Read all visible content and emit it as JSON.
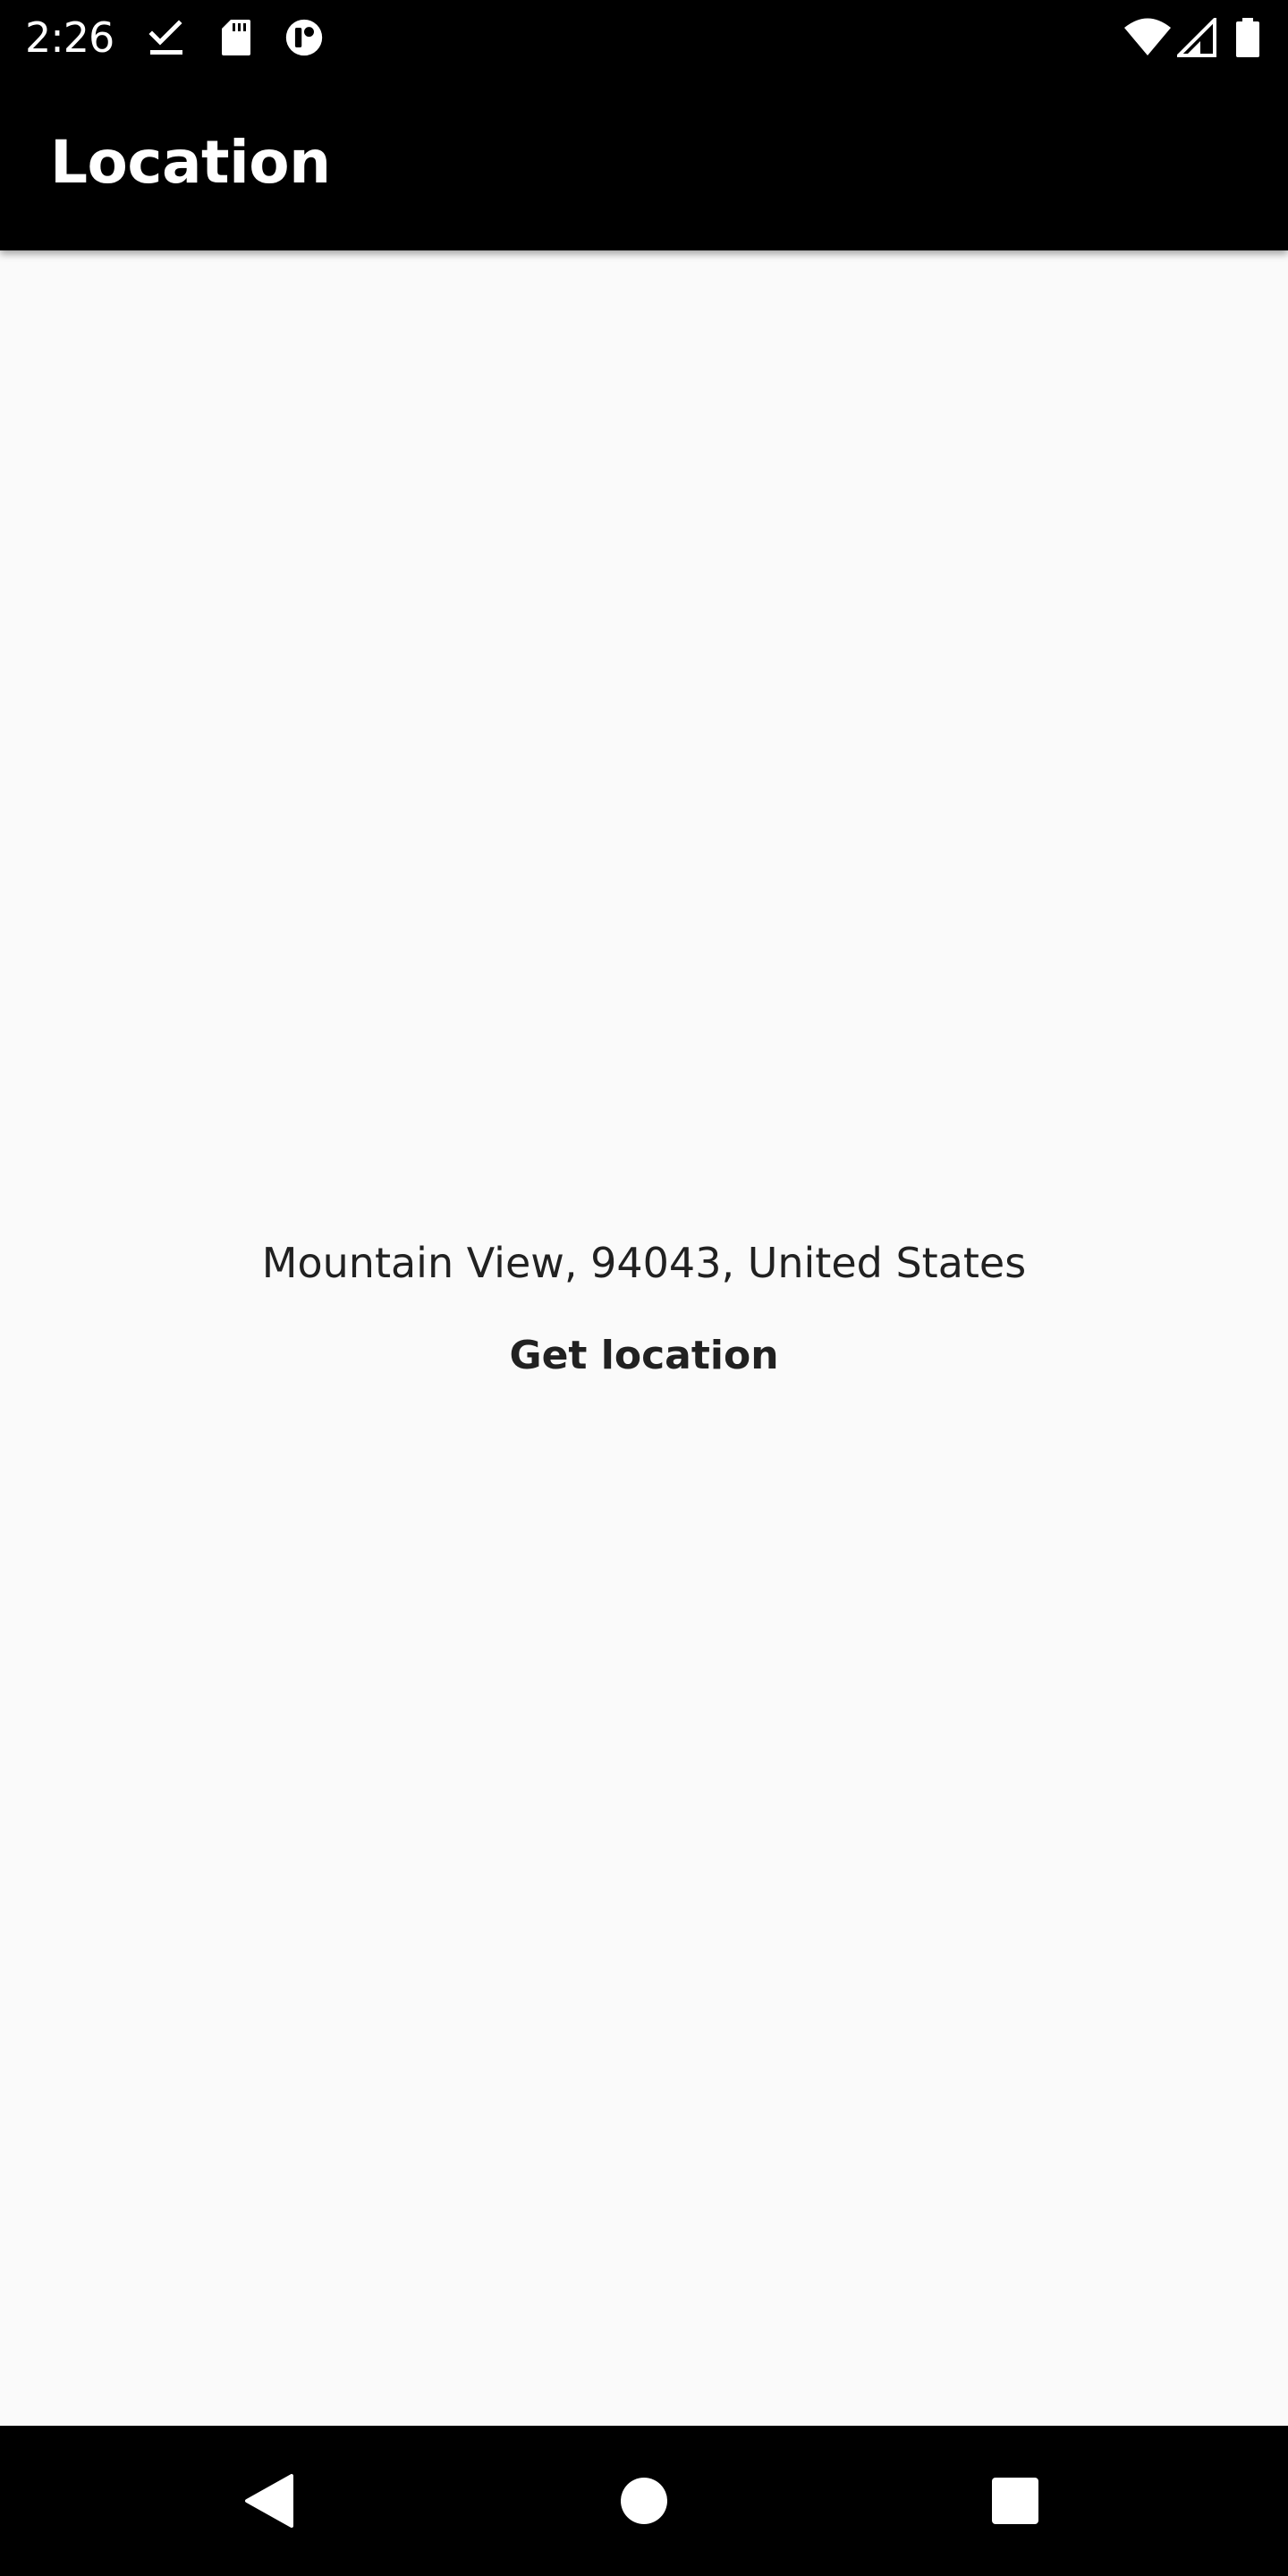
{
  "status_bar": {
    "time": "2:26",
    "left_icons": [
      "download-done-icon",
      "sd-card-icon",
      "app-notification-icon"
    ],
    "right_icons": [
      "wifi-icon",
      "signal-icon",
      "battery-icon"
    ]
  },
  "app_bar": {
    "title": "Location"
  },
  "main": {
    "address": "Mountain View, 94043, United States",
    "get_location_label": "Get location"
  },
  "nav_bar": {
    "buttons": [
      "back-icon",
      "home-icon",
      "recents-icon"
    ]
  },
  "colors": {
    "bars": "#000000",
    "background": "#fafafa",
    "text": "#212121",
    "bar_text": "#ffffff"
  }
}
